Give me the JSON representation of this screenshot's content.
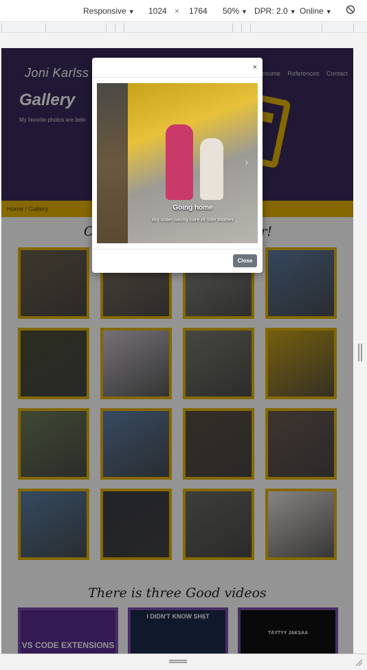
{
  "devtools": {
    "device": "Responsive",
    "width": "1024",
    "times": "×",
    "height": "1764",
    "zoom": "50%",
    "dpr": "DPR: 2.0",
    "network": "Online"
  },
  "site": {
    "brand": "Joni Karlss",
    "nav": [
      "Resume",
      "References",
      "Contact"
    ],
    "title": "Gallery",
    "subtitle": "My favorite photos are belo",
    "breadcrumb": "Home / Gallery",
    "gallery_heading_left": "C",
    "gallery_heading_right": "r!",
    "videos_heading": "There is three Good videos",
    "videos": [
      {
        "label": "VS CODE EXTENSIONS",
        "bg": "#5a2d91"
      },
      {
        "label": "I DIDN'T KNOW SH§T",
        "bg": "#1d2a4a"
      },
      {
        "label": "TÄYTYY JAKSAA",
        "bg": "#111111"
      }
    ]
  },
  "modal": {
    "close_x": "×",
    "caption_title": "Going home",
    "caption_text": "Big sister taking care of little brother",
    "next_arrow": "›",
    "close_button": "Close"
  },
  "colors": {
    "hero_bg": "#3a2a5c",
    "accent": "#e5b300",
    "button": "#6c757d"
  },
  "thumbnails": [
    "#6b5e4c",
    "#7d7060",
    "#8a8a86",
    "#5d7aa0",
    "#4a4e3a",
    "#c9c4cb",
    "#7a7a70",
    "#c9a21b",
    "#6e7d5a",
    "#5f7fa8",
    "#5a4e44",
    "#6b5a52",
    "#5a7fa5",
    "#3a3d44",
    "#6a6a66",
    "#e8e4e0"
  ]
}
